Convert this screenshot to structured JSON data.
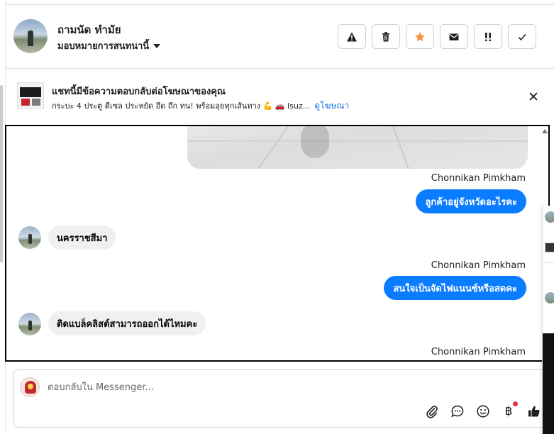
{
  "header": {
    "contact_name": "ถามนัด ทำมัย",
    "assign_label": "มอบหมายการสนทนานี้"
  },
  "actions": [
    {
      "name": "report-spam-button",
      "icon": "warning-icon"
    },
    {
      "name": "delete-button",
      "icon": "trash-icon"
    },
    {
      "name": "star-button",
      "icon": "star-icon"
    },
    {
      "name": "mark-unread-button",
      "icon": "envelope-icon"
    },
    {
      "name": "follow-up-button",
      "icon": "double-exclamation-icon"
    },
    {
      "name": "mark-done-button",
      "icon": "check-icon"
    }
  ],
  "colors": {
    "accent": "#0a7cff",
    "star": "#f7923a",
    "link": "#1b74e4",
    "incoming_bubble": "#f0f0f0"
  },
  "ad_banner": {
    "title": "แชทนี้มีข้อความตอบกลับต่อโฆษณาของคุณ",
    "subtitle": "กระบะ 4 ประตู ดีเซล ประหยัด อึด ถึก ทน! พร้อมลุยทุกเส้นทาง 💪 🚗 Isuz...",
    "link": "ดูโฆษณา"
  },
  "messages": {
    "sender_1": "Chonnikan Pimkham",
    "out_1": "ลูกค้าอยู่จังหวัดอะไรคะ",
    "in_1": "นครราชสีมา",
    "sender_2": "Chonnikan Pimkham",
    "out_2": "สนใจเป็นจัดไฟแนนซ์หรือสดคะ",
    "in_2": "ติดแบล็คลิสต์สามารถออกได้ไหมคะ",
    "sender_3": "Chonnikan Pimkham"
  },
  "composer": {
    "placeholder": "ตอบกลับใน Messenger...",
    "baht_symbol": "฿"
  }
}
